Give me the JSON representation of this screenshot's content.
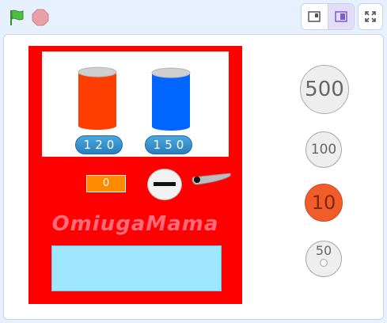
{
  "toolbar": {
    "green_flag_icon": "green-flag-icon",
    "stop_icon": "stop-icon",
    "layout_small_icon": "small-stage-icon",
    "layout_large_icon": "large-stage-icon",
    "fullscreen_icon": "fullscreen-icon"
  },
  "machine": {
    "products": [
      {
        "price": "120",
        "color": "#ff3d00"
      },
      {
        "price": "150",
        "color": "#0066ff"
      }
    ],
    "inserted_amount": "0",
    "brand": "OmiugaMama"
  },
  "coins": [
    {
      "label": "500"
    },
    {
      "label": "100"
    },
    {
      "label": "10"
    },
    {
      "label": "50"
    }
  ],
  "colors": {
    "machine_body": "#ff0000",
    "outlet": "#9fe6ff",
    "amount_display": "#ff8a00",
    "price_button": "#2a7fbd"
  }
}
